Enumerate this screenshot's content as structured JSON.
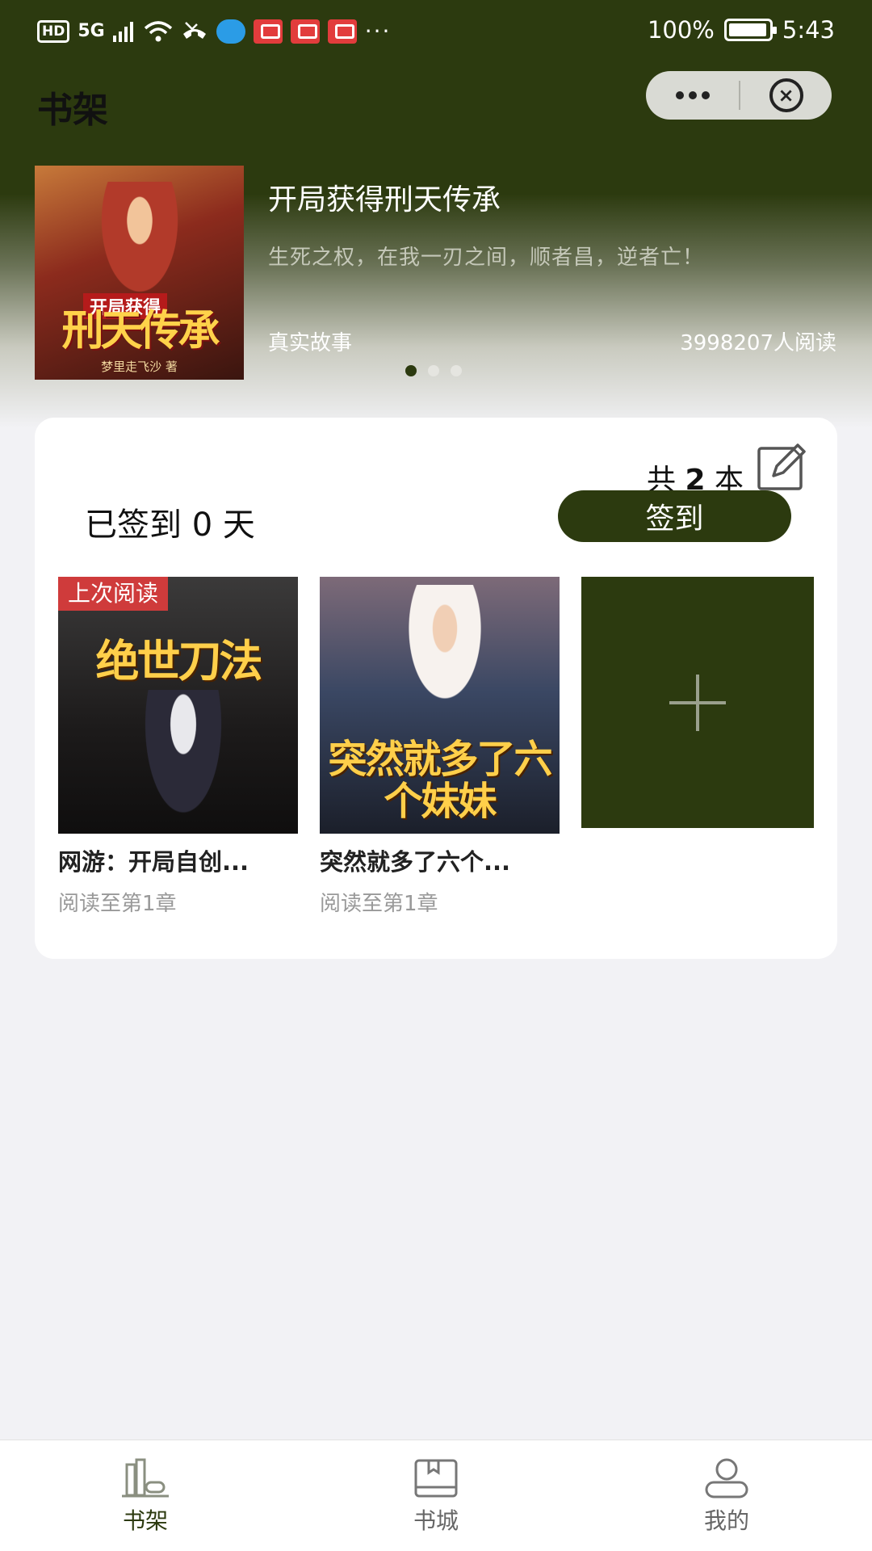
{
  "status_bar": {
    "hd": "HD",
    "network": "5G",
    "battery_text": "100%",
    "time": "5:43",
    "more": "···"
  },
  "header": {
    "title": "书架"
  },
  "banner": {
    "title": "开局获得刑天传承",
    "description": "生死之权，在我一刃之间，顺者昌，逆者亡！",
    "tag": "真实故事",
    "reads": "3998207人阅读",
    "cover_top": "开局获得",
    "cover_title": "刑天传承",
    "cover_author": "梦里走飞沙 著",
    "active_dot": 0,
    "dot_count": 3
  },
  "shelf": {
    "count_prefix": "共",
    "count": "2",
    "count_suffix": "本",
    "checkin_text": "已签到 0 天",
    "checkin_button": "签到",
    "books": [
      {
        "cover_title": "绝世刀法",
        "name": "网游：开局自创...",
        "progress": "阅读至第1章",
        "tag": "上次阅读"
      },
      {
        "cover_title": "突然就多了六个妹妹",
        "name": "突然就多了六个...",
        "progress": "阅读至第1章"
      }
    ]
  },
  "tab_bar": {
    "tabs": [
      {
        "label": "书架",
        "icon": "bookshelf-icon",
        "active": true
      },
      {
        "label": "书城",
        "icon": "book-icon",
        "active": false
      },
      {
        "label": "我的",
        "icon": "user-icon",
        "active": false
      }
    ]
  },
  "colors": {
    "brand": "#2c3a0f",
    "last_read_tag": "#dc3c3c"
  }
}
